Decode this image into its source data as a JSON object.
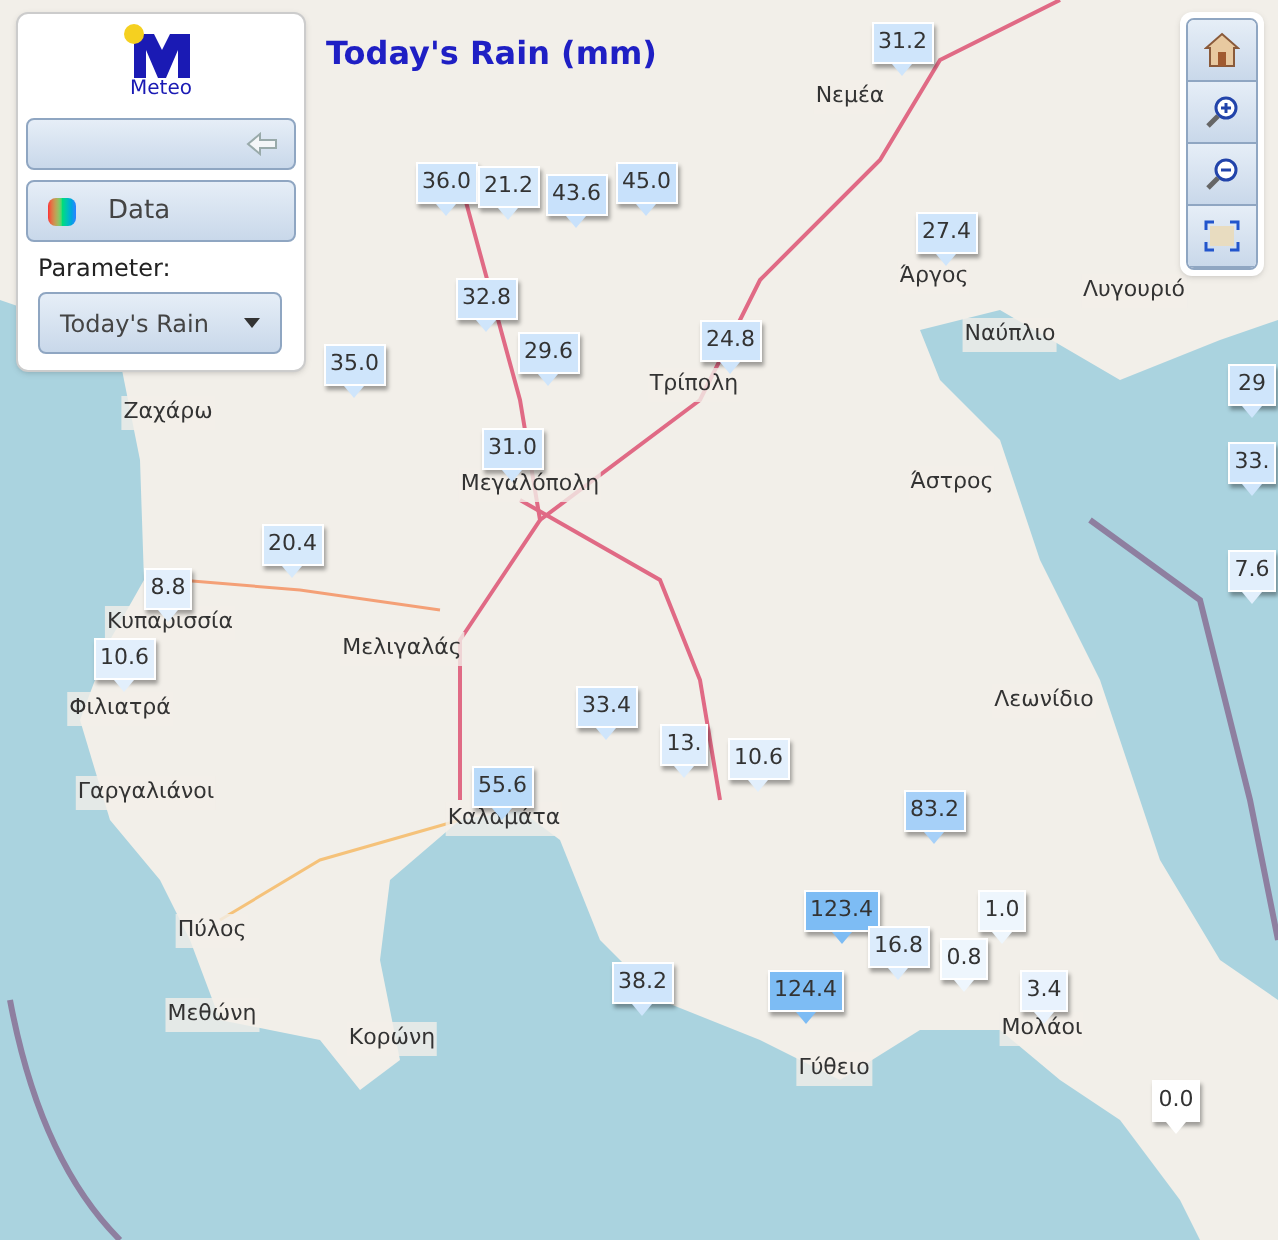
{
  "panel": {
    "logo_text": "Meteo",
    "data_button": "Data",
    "parameter_label": "Parameter:",
    "parameter_select": "Today's Rain"
  },
  "map_title": "Today's Rain (mm)",
  "places": [
    "Νεμέα",
    "Άργος",
    "Ναύπλιο",
    "Λυγουριό",
    "Τρίπολη",
    "Ζαχάρω",
    "Μεγαλόπολη",
    "Άστρος",
    "Κυπαρισσία",
    "Μελιγαλάς",
    "Φιλιατρά",
    "Λεωνίδιο",
    "Γαργαλιάνοι",
    "Καλαμάτα",
    "Πύλος",
    "Μεθώνη",
    "Κορώνη",
    "Μολάοι",
    "Γύθειο"
  ],
  "markers": [
    {
      "value": "31.2",
      "color": "#cfe5fb"
    },
    {
      "value": "36.0",
      "color": "#cfe5fb"
    },
    {
      "value": "21.2",
      "color": "#d6e9fb"
    },
    {
      "value": "43.6",
      "color": "#c8e1fb"
    },
    {
      "value": "45.0",
      "color": "#c8e1fb"
    },
    {
      "value": "27.4",
      "color": "#cfe5fb"
    },
    {
      "value": "32.8",
      "color": "#cfe5fb"
    },
    {
      "value": "29.6",
      "color": "#cfe5fb"
    },
    {
      "value": "24.8",
      "color": "#cfe5fb"
    },
    {
      "value": "35.0",
      "color": "#cfe5fb"
    },
    {
      "value": "31.0",
      "color": "#cfe5fb"
    },
    {
      "value": "20.4",
      "color": "#d6e9fb"
    },
    {
      "value": "8.8",
      "color": "#e2effc"
    },
    {
      "value": "10.6",
      "color": "#e2effc"
    },
    {
      "value": "33.4",
      "color": "#cfe5fb"
    },
    {
      "value": "13.",
      "color": "#dcecfc"
    },
    {
      "value": "10.6",
      "color": "#e2effc"
    },
    {
      "value": "55.6",
      "color": "#b9daf9"
    },
    {
      "value": "83.2",
      "color": "#a6d0f8"
    },
    {
      "value": "123.4",
      "color": "#7dbcf4"
    },
    {
      "value": "1.0",
      "color": "#eef6fd"
    },
    {
      "value": "16.8",
      "color": "#dcecfc"
    },
    {
      "value": "0.8",
      "color": "#eef6fd"
    },
    {
      "value": "38.2",
      "color": "#cfe5fb"
    },
    {
      "value": "124.4",
      "color": "#7dbcf4"
    },
    {
      "value": "3.4",
      "color": "#e8f2fd"
    },
    {
      "value": "0.0",
      "color": "#ffffff"
    },
    {
      "value": "29",
      "color": "#cfe5fb"
    },
    {
      "value": "33.",
      "color": "#cfe5fb"
    },
    {
      "value": "7.6",
      "color": "#e2effc"
    }
  ]
}
